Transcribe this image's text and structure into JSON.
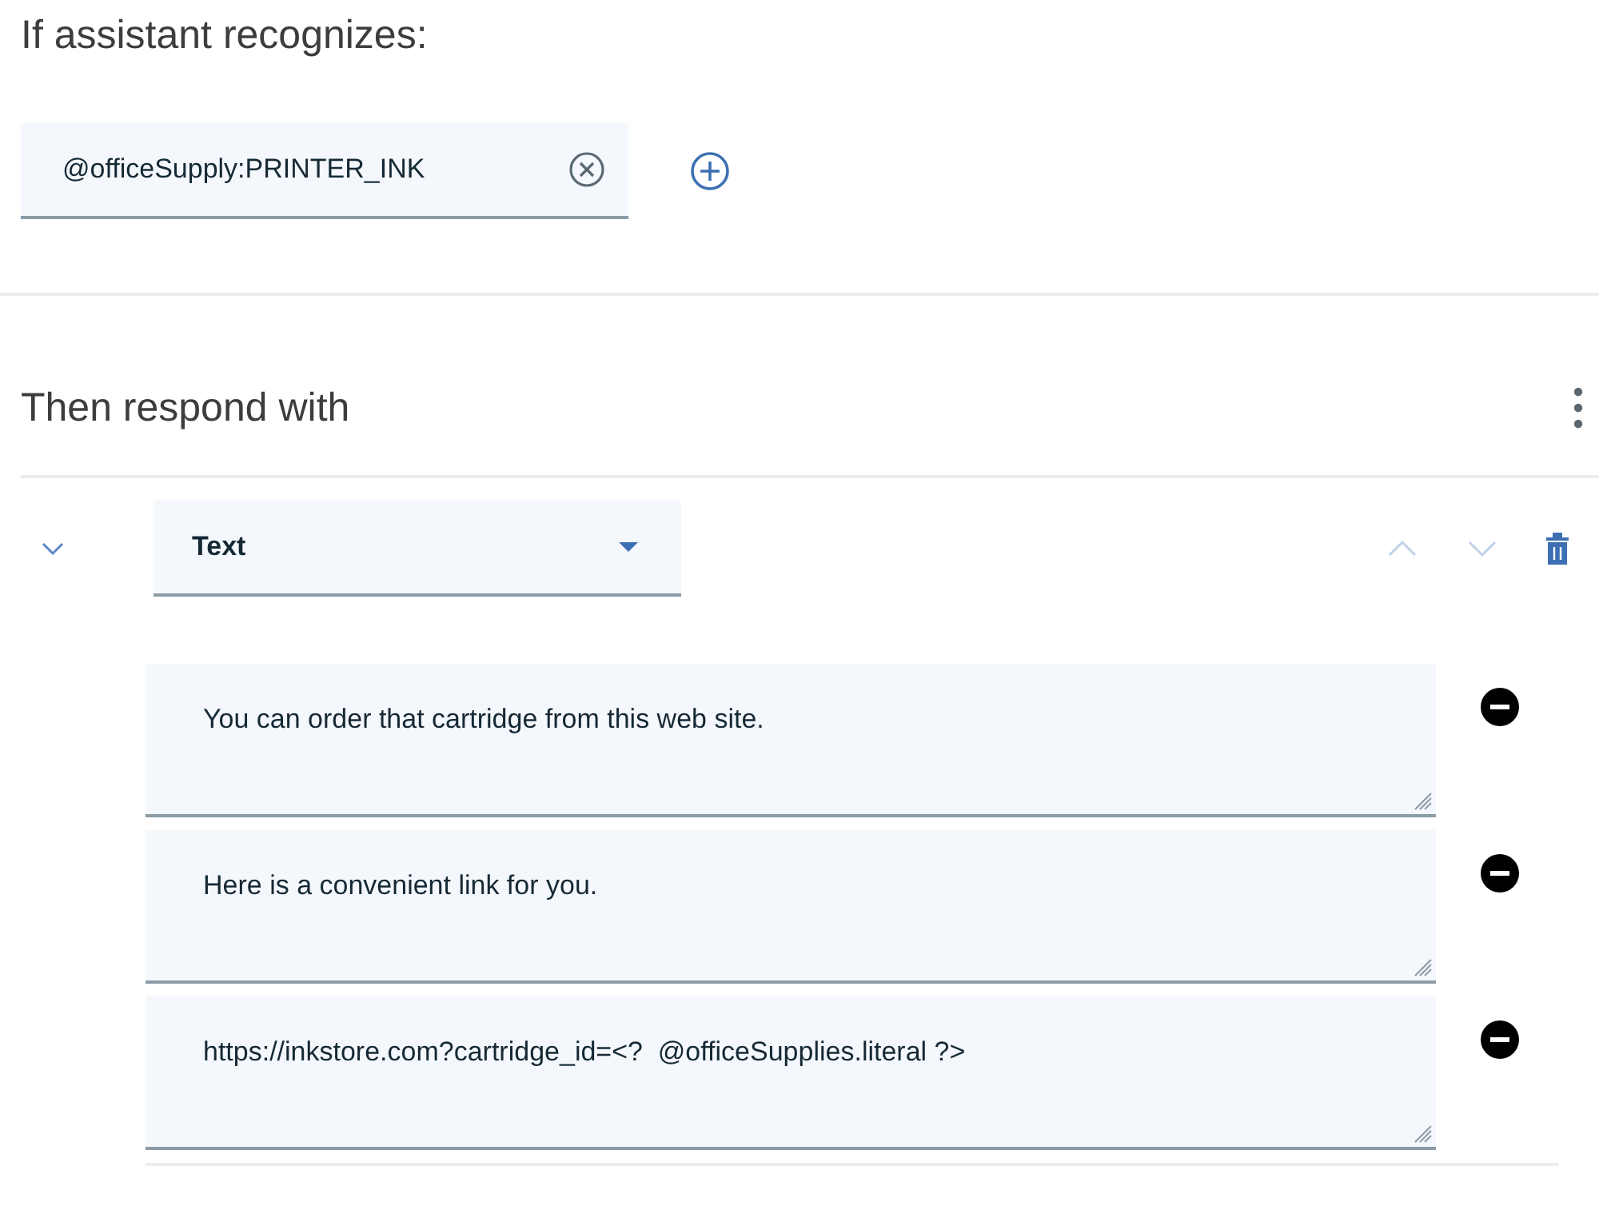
{
  "condition": {
    "title": "If assistant recognizes:",
    "chips": [
      {
        "label": "@officeSupply:PRINTER_INK"
      }
    ]
  },
  "response": {
    "title": "Then respond with",
    "items": [
      {
        "type": "Text",
        "expanded": true,
        "values": [
          "You can order that cartridge from this web site.",
          "Here is a convenient link for you.",
          "https://inkstore.com?cartridge_id=<?  @officeSupplies.literal ?>"
        ]
      }
    ]
  }
}
